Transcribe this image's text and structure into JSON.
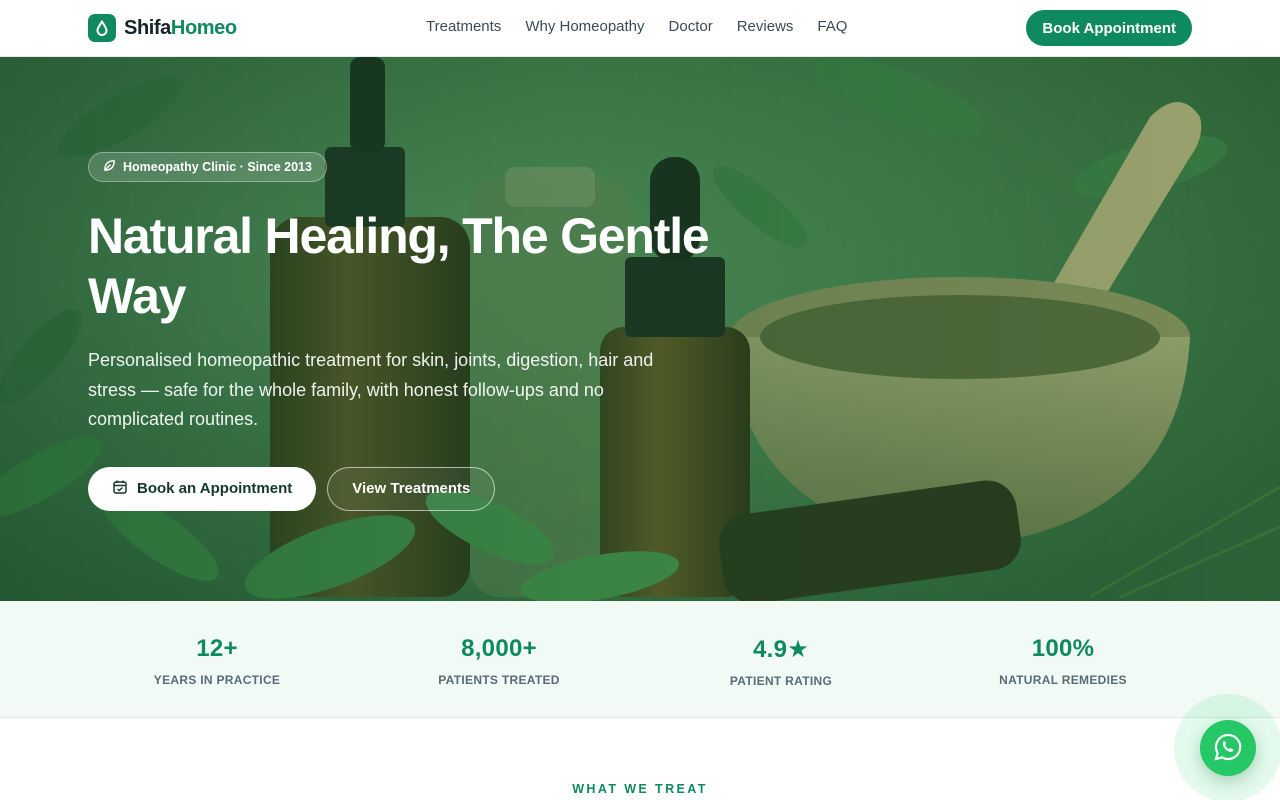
{
  "nav": {
    "logo_primary": "Shifa",
    "logo_accent": "Homeo",
    "links": [
      "Treatments",
      "Why Homeopathy",
      "Doctor",
      "Reviews",
      "FAQ"
    ],
    "cta": "Book Appointment"
  },
  "hero": {
    "badge": "Homeopathy Clinic · Since 2013",
    "title": "Natural Healing, The Gentle Way",
    "subtitle": "Personalised homeopathic treatment for skin, joints, digestion, hair and stress — safe for the whole family, with honest follow-ups and no complicated routines.",
    "primary_button": "Book an Appointment",
    "secondary_button": "View Treatments"
  },
  "stats": [
    {
      "value": "12+",
      "label": "YEARS IN PRACTICE"
    },
    {
      "value": "8,000+",
      "label": "PATIENTS TREATED"
    },
    {
      "value": "4.9★",
      "label": "PATIENT RATING"
    },
    {
      "value": "100%",
      "label": "NATURAL REMEDIES"
    }
  ],
  "section": {
    "label": "WHAT WE TREAT"
  },
  "colors": {
    "brand": "#0f8a5f",
    "whatsapp": "#25c766",
    "stats_bg": "#f1faf5"
  },
  "icons": {
    "logo": "drop-icon",
    "badge": "leaf-icon",
    "book": "calendar-icon",
    "float": "whatsapp-icon"
  }
}
